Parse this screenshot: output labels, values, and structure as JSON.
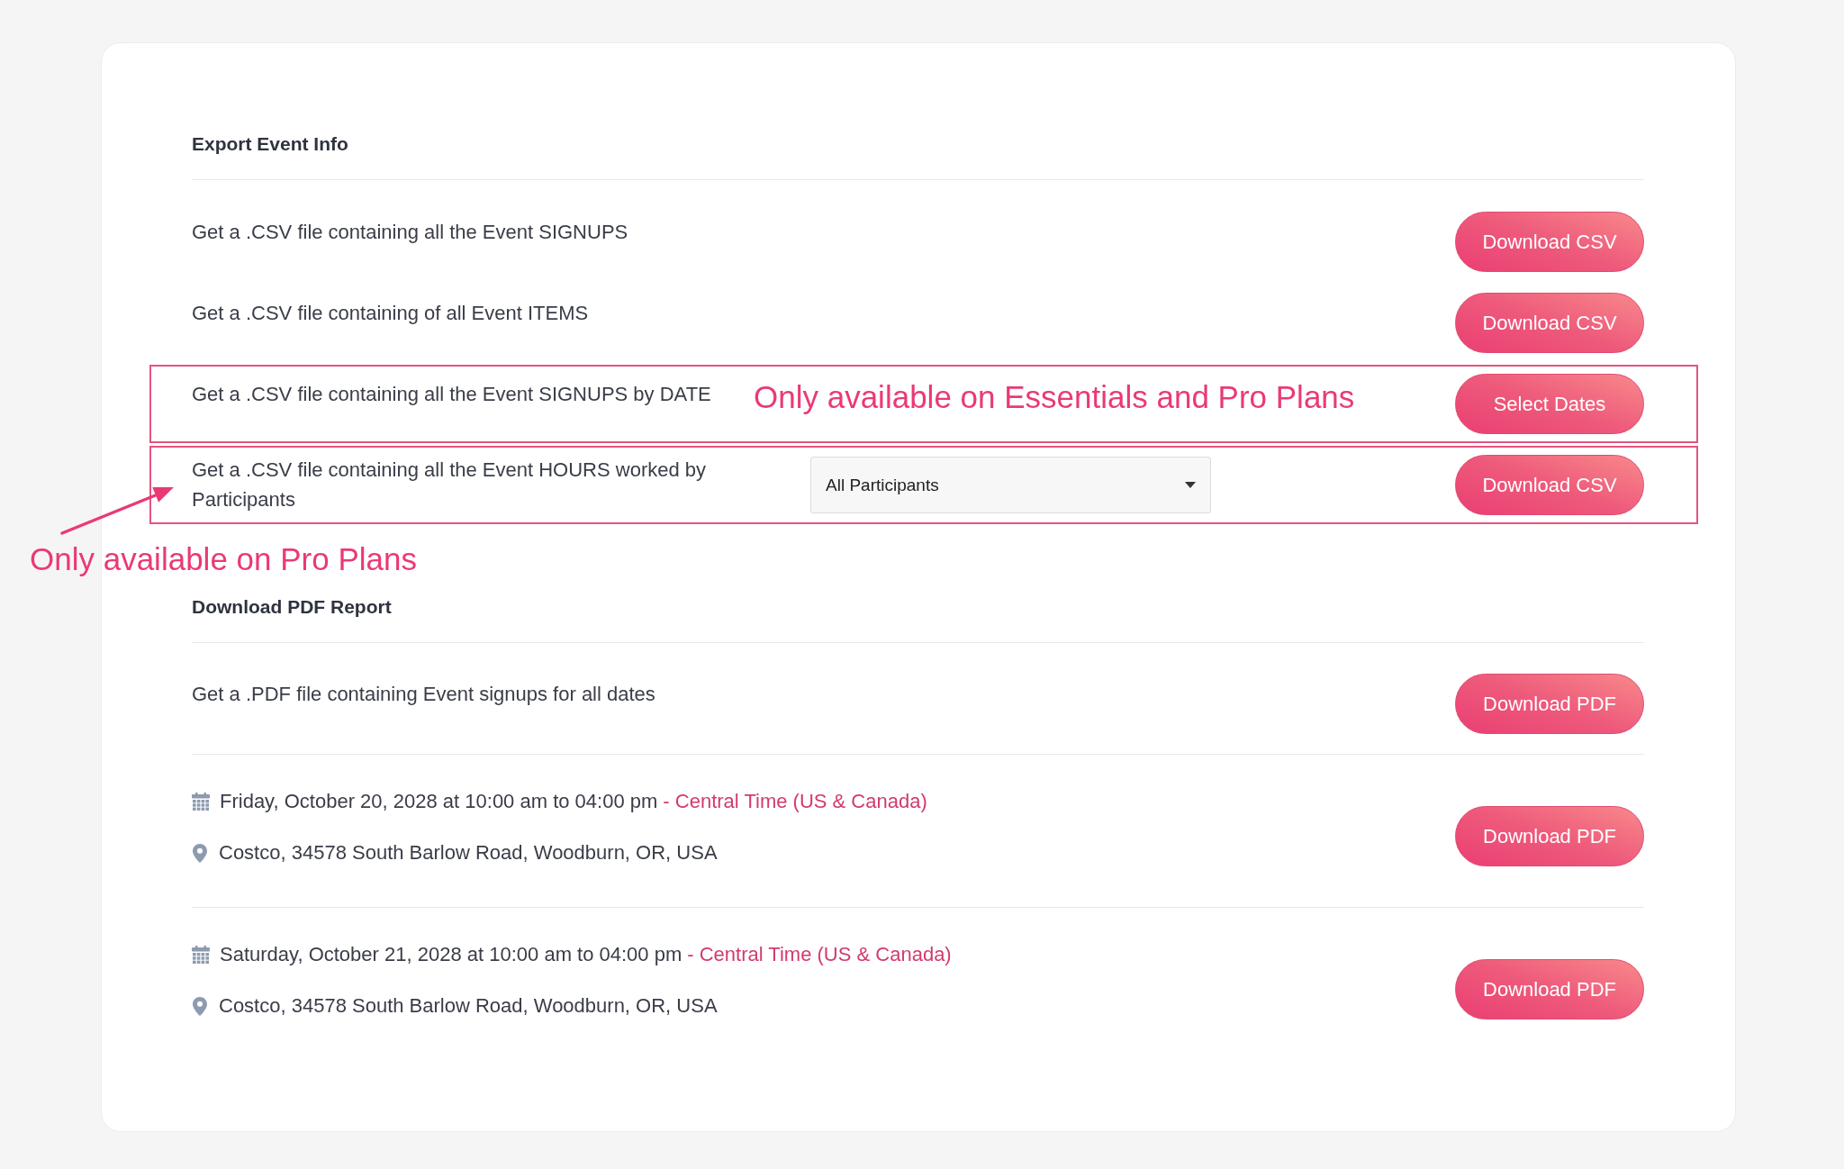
{
  "export_section": {
    "title": "Export Event Info",
    "rows": [
      {
        "kind": "plain",
        "description": "Get a .CSV file containing all the Event SIGNUPS",
        "button": "Download CSV",
        "highlighted": false
      },
      {
        "kind": "plain",
        "description": "Get a .CSV file containing of all Event ITEMS",
        "button": "Download CSV",
        "highlighted": false
      },
      {
        "kind": "note",
        "description": "Get a .CSV file containing all the Event SIGNUPS by DATE",
        "note": "Only available on Essentials and Pro Plans",
        "button": "Select Dates",
        "highlighted": true
      },
      {
        "kind": "dropdown",
        "description": "Get a .CSV file containing all the Event HOURS worked by Participants",
        "dropdown": {
          "value": "All Participants"
        },
        "button": "Download CSV",
        "highlighted": true
      }
    ]
  },
  "callout": {
    "text": "Only available on Pro Plans"
  },
  "pdf_section": {
    "title": "Download PDF Report",
    "summary_row": {
      "description": "Get a .PDF file containing Event signups for all dates",
      "button": "Download PDF"
    },
    "dates": [
      {
        "date": "Friday, October 20, 2028 at 10:00 am to 04:00 pm",
        "timezone": "- Central Time (US & Canada)",
        "location": "Costco, 34578 South Barlow Road, Woodburn, OR, USA",
        "button": "Download PDF"
      },
      {
        "date": "Saturday, October 21, 2028 at 10:00 am to 04:00 pm",
        "timezone": "- Central Time (US & Canada)",
        "location": "Costco, 34578 South Barlow Road, Woodburn, OR, USA",
        "button": "Download PDF"
      }
    ]
  }
}
